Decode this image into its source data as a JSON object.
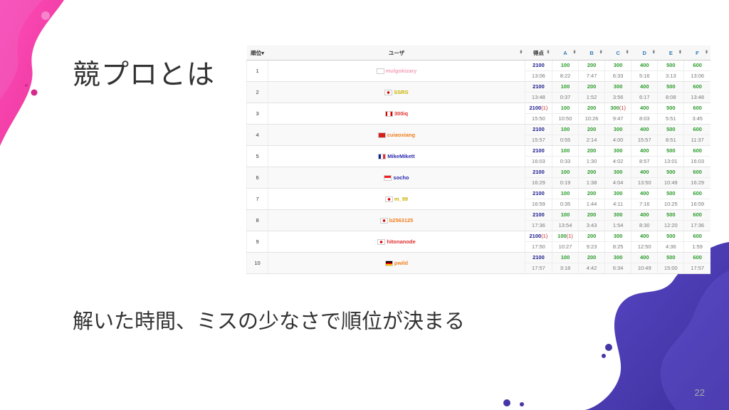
{
  "slide": {
    "title": "競プロとは",
    "subtitle": "解いた時間、ミスの少なさで順位が決まる",
    "page_number": "22"
  },
  "colors": {
    "accent_pink": "#e8399a",
    "accent_purple": "#4b3fb0"
  },
  "table": {
    "headers": [
      "順位▾",
      "ユーザ",
      "得点",
      "A",
      "B",
      "C",
      "D",
      "E",
      "F"
    ],
    "rows": [
      {
        "rank": "1",
        "flag": "kr-flag-icon",
        "user": "mulgokizary",
        "user_color": "#f4a0b8",
        "score": "2100",
        "score_pen": "",
        "time": "13:06",
        "probs": [
          [
            "100",
            "",
            "8:22"
          ],
          [
            "200",
            "",
            "7:47"
          ],
          [
            "300",
            "",
            "6:33"
          ],
          [
            "400",
            "",
            "5:16"
          ],
          [
            "500",
            "",
            "3:13"
          ],
          [
            "600",
            "",
            "13:06"
          ]
        ]
      },
      {
        "rank": "2",
        "flag": "jp-flag-icon",
        "user": "SSRS",
        "user_color": "#c8b400",
        "score": "2100",
        "score_pen": "",
        "time": "13:48",
        "probs": [
          [
            "100",
            "",
            "0:37"
          ],
          [
            "200",
            "",
            "1:52"
          ],
          [
            "300",
            "",
            "3:56"
          ],
          [
            "400",
            "",
            "6:17"
          ],
          [
            "500",
            "",
            "8:08"
          ],
          [
            "600",
            "",
            "13:48"
          ]
        ]
      },
      {
        "rank": "3",
        "flag": "ca-flag-icon",
        "user": "300iq",
        "user_color": "#e03030",
        "score": "2100",
        "score_pen": "(1)",
        "time": "15:50",
        "probs": [
          [
            "100",
            "",
            "10:50"
          ],
          [
            "200",
            "",
            "10:26"
          ],
          [
            "300",
            "(1)",
            "9:47"
          ],
          [
            "400",
            "",
            "8:03"
          ],
          [
            "500",
            "",
            "5:51"
          ],
          [
            "600",
            "",
            "3:45"
          ]
        ]
      },
      {
        "rank": "4",
        "flag": "cn-flag-icon",
        "user": "cuiaoxiang",
        "user_color": "#f08020",
        "score": "2100",
        "score_pen": "",
        "time": "15:57",
        "probs": [
          [
            "100",
            "",
            "0:55"
          ],
          [
            "200",
            "",
            "2:14"
          ],
          [
            "300",
            "",
            "4:00"
          ],
          [
            "400",
            "",
            "15:57"
          ],
          [
            "500",
            "",
            "8:51"
          ],
          [
            "600",
            "",
            "11:37"
          ]
        ]
      },
      {
        "rank": "5",
        "flag": "fr-flag-icon",
        "user": "MikeMikett",
        "user_color": "#2a2ab0",
        "score": "2100",
        "score_pen": "",
        "time": "16:03",
        "probs": [
          [
            "100",
            "",
            "0:33"
          ],
          [
            "200",
            "",
            "1:30"
          ],
          [
            "300",
            "",
            "4:02"
          ],
          [
            "400",
            "",
            "8:57"
          ],
          [
            "500",
            "",
            "13:01"
          ],
          [
            "600",
            "",
            "16:03"
          ]
        ]
      },
      {
        "rank": "6",
        "flag": "sg-flag-icon",
        "user": "socho",
        "user_color": "#2a2ab0",
        "score": "2100",
        "score_pen": "",
        "time": "16:29",
        "probs": [
          [
            "100",
            "",
            "0:19"
          ],
          [
            "200",
            "",
            "1:38"
          ],
          [
            "300",
            "",
            "4:04"
          ],
          [
            "400",
            "",
            "13:50"
          ],
          [
            "500",
            "",
            "10:49"
          ],
          [
            "600",
            "",
            "16:29"
          ]
        ]
      },
      {
        "rank": "7",
        "flag": "jp-flag-icon",
        "user": "m_99",
        "user_color": "#c8b400",
        "score": "2100",
        "score_pen": "",
        "time": "16:59",
        "probs": [
          [
            "100",
            "",
            "0:35"
          ],
          [
            "200",
            "",
            "1:44"
          ],
          [
            "300",
            "",
            "4:11"
          ],
          [
            "400",
            "",
            "7:16"
          ],
          [
            "500",
            "",
            "10:25"
          ],
          [
            "600",
            "",
            "16:59"
          ]
        ]
      },
      {
        "rank": "8",
        "flag": "jp-flag-icon",
        "user": "b2563125",
        "user_color": "#f08020",
        "score": "2100",
        "score_pen": "",
        "time": "17:36",
        "probs": [
          [
            "100",
            "",
            "13:54"
          ],
          [
            "200",
            "",
            "3:43"
          ],
          [
            "300",
            "",
            "1:54"
          ],
          [
            "400",
            "",
            "8:30"
          ],
          [
            "500",
            "",
            "12:20"
          ],
          [
            "600",
            "",
            "17:36"
          ]
        ]
      },
      {
        "rank": "9",
        "flag": "jp-flag-icon",
        "user": "hitonanode",
        "user_color": "#e03030",
        "score": "2100",
        "score_pen": "(1)",
        "time": "17:50",
        "probs": [
          [
            "100",
            "(1)",
            "10:27"
          ],
          [
            "200",
            "",
            "9:23"
          ],
          [
            "300",
            "",
            "8:25"
          ],
          [
            "400",
            "",
            "12:50"
          ],
          [
            "500",
            "",
            "4:36"
          ],
          [
            "600",
            "",
            "1:59"
          ]
        ]
      },
      {
        "rank": "10",
        "flag": "de-flag-icon",
        "user": "pwild",
        "user_color": "#f08020",
        "score": "2100",
        "score_pen": "",
        "time": "17:57",
        "probs": [
          [
            "100",
            "",
            "3:18"
          ],
          [
            "200",
            "",
            "4:42"
          ],
          [
            "300",
            "",
            "6:34"
          ],
          [
            "400",
            "",
            "10:49"
          ],
          [
            "500",
            "",
            "15:00"
          ],
          [
            "600",
            "",
            "17:57"
          ]
        ]
      }
    ]
  }
}
